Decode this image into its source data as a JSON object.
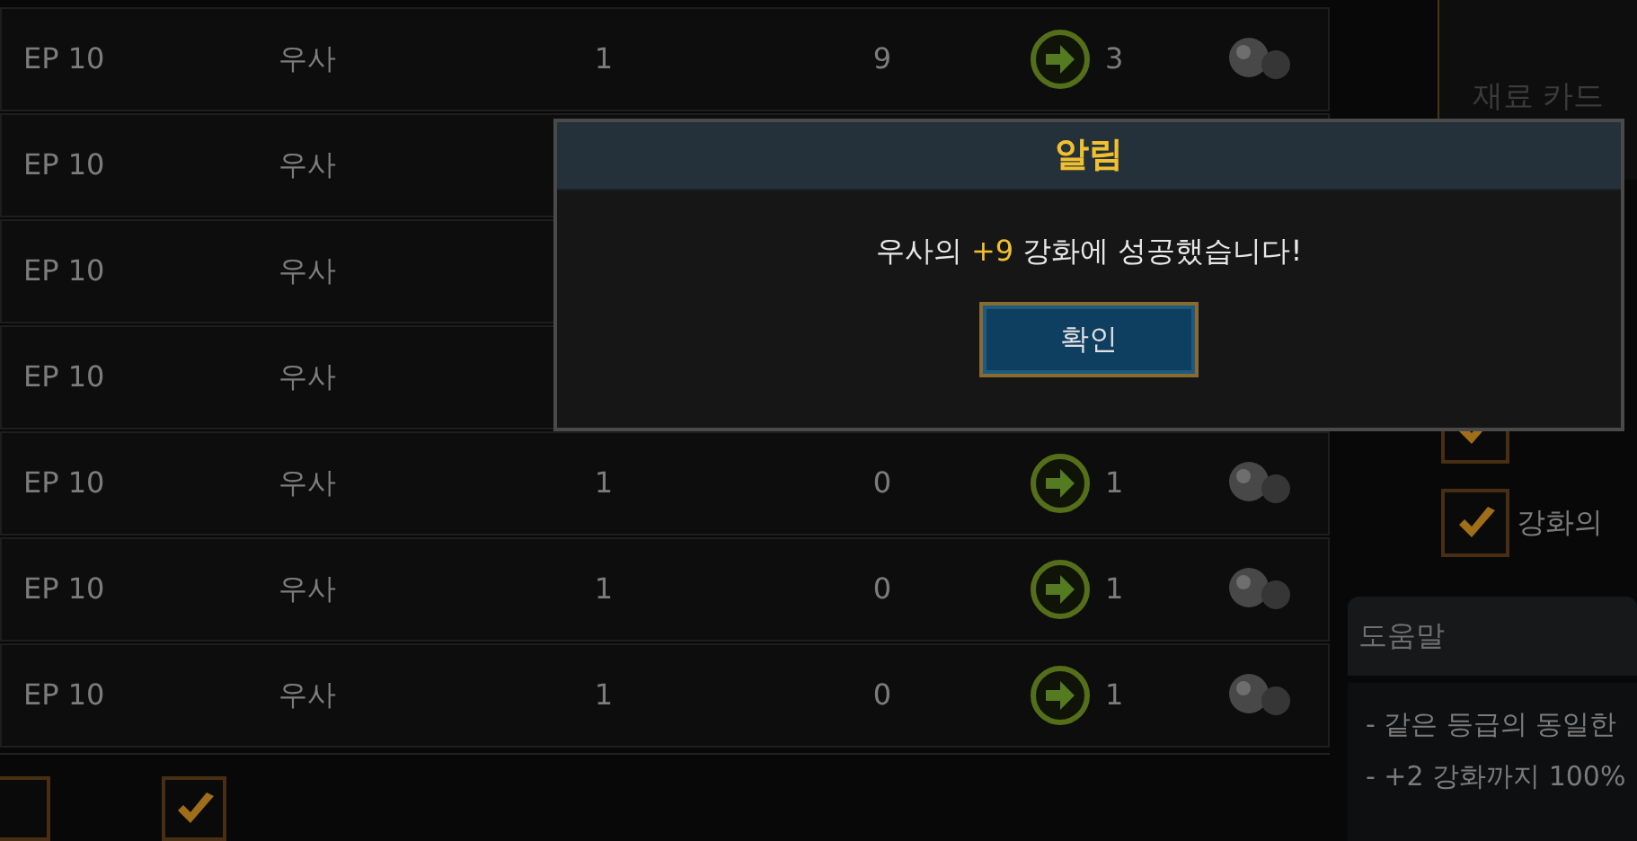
{
  "rows": [
    {
      "episode": "EP 10",
      "name": "우사",
      "column_3": "1",
      "column_4": "9",
      "result": "3"
    },
    {
      "episode": "EP 10",
      "name": "우사"
    },
    {
      "episode": "EP 10",
      "name": "우사"
    },
    {
      "episode": "EP 10",
      "name": "우사"
    },
    {
      "episode": "EP 10",
      "name": "우사",
      "column_3": "1",
      "column_4": "0",
      "result": "1"
    },
    {
      "episode": "EP 10",
      "name": "우사",
      "column_3": "1",
      "column_4": "0",
      "result": "1"
    },
    {
      "episode": "EP 10",
      "name": "우사",
      "column_3": "1",
      "column_4": "0",
      "result": "1"
    }
  ],
  "bottom_checkboxes": [
    {
      "checked": false
    },
    {
      "checked": true
    }
  ],
  "side_panel": {
    "title": "재료 카드",
    "options": [
      {
        "checked": true
      },
      {
        "label": "강화의",
        "checked": true
      }
    ],
    "help": {
      "title": "도움말",
      "lines": [
        "- 같은 등급의 동일한",
        "- +2 강화까지 100%"
      ]
    }
  },
  "dialog": {
    "title": "알림",
    "message": {
      "before": "우사의 ",
      "highlight": "+9",
      "after": " 강화에 성공했습니다!"
    },
    "button": "확인"
  }
}
